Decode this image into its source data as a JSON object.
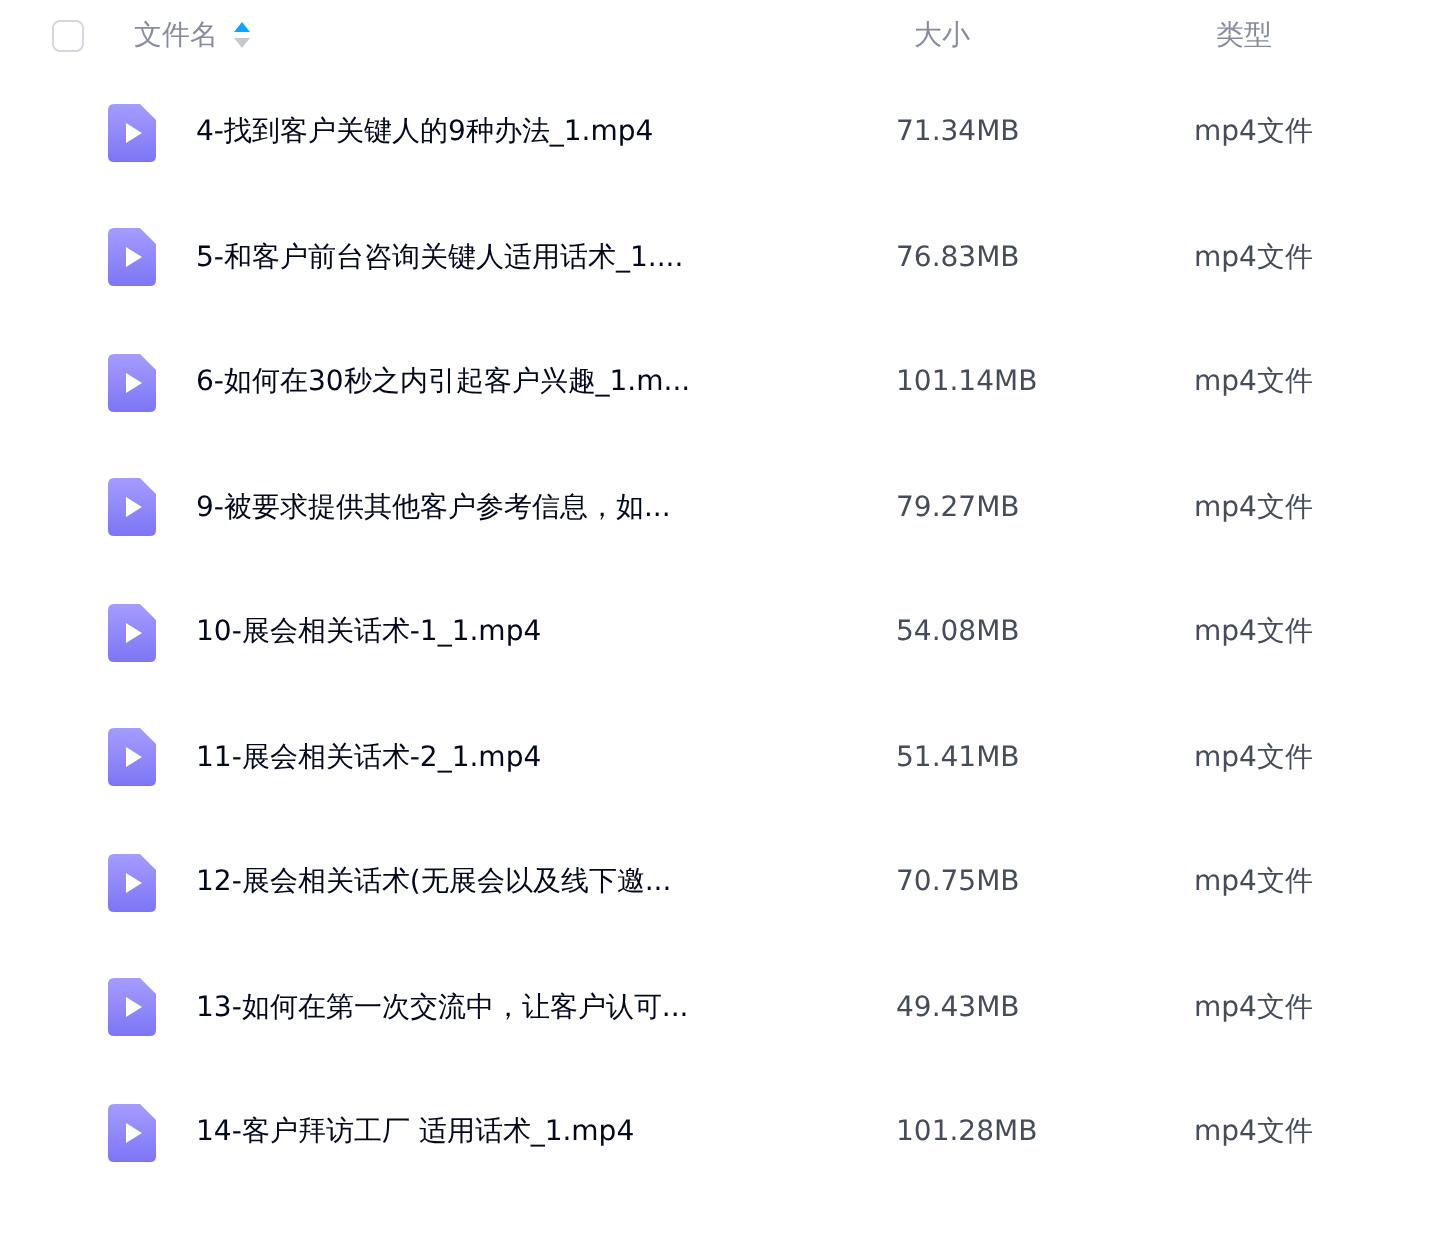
{
  "header": {
    "select_all": {
      "checked": false
    },
    "columns": [
      {
        "label": "文件名",
        "sort_ascending": true
      },
      {
        "label": "大小"
      },
      {
        "label": "类型"
      }
    ]
  },
  "rows": [
    {
      "name": "4-找到客户关键人的9种办法_1.mp4",
      "size": "71.34MB",
      "type": "mp4文件"
    },
    {
      "name": "5-和客户前台咨询关键人适用话术_1....",
      "size": "76.83MB",
      "type": "mp4文件"
    },
    {
      "name": "6-如何在30秒之内引起客户兴趣_1.m...",
      "size": "101.14MB",
      "type": "mp4文件"
    },
    {
      "name": "9-被要求提供其他客户参考信息，如...",
      "size": "79.27MB",
      "type": "mp4文件"
    },
    {
      "name": "10-展会相关话术-1_1.mp4",
      "size": "54.08MB",
      "type": "mp4文件"
    },
    {
      "name": "11-展会相关话术-2_1.mp4",
      "size": "51.41MB",
      "type": "mp4文件"
    },
    {
      "name": "12-展会相关话术(无展会以及线下邀...",
      "size": "70.75MB",
      "type": "mp4文件"
    },
    {
      "name": "13-如何在第一次交流中，让客户认可...",
      "size": "49.43MB",
      "type": "mp4文件"
    },
    {
      "name": "14-客户拜访工厂 适用话术_1.mp4",
      "size": "101.28MB",
      "type": "mp4文件"
    }
  ]
}
